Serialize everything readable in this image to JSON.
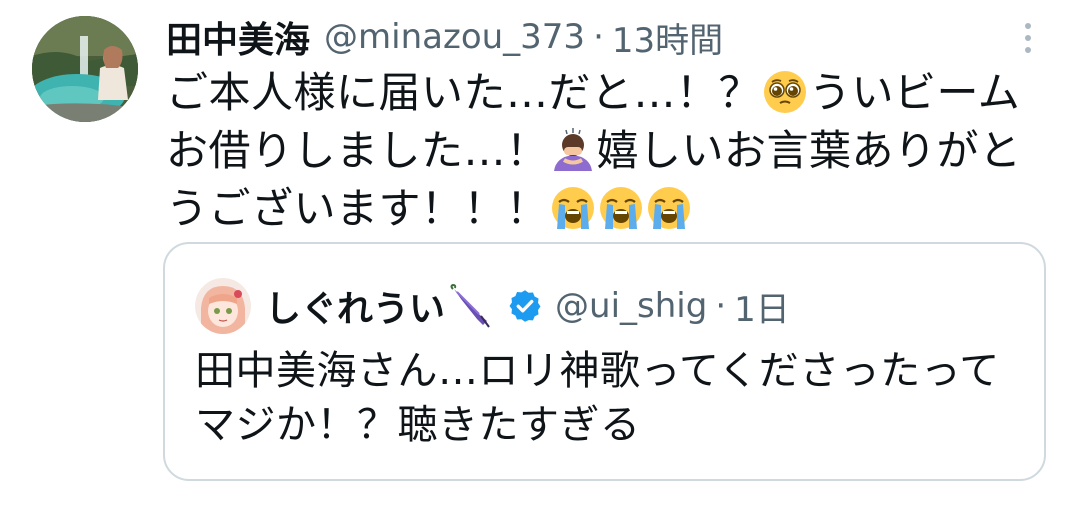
{
  "tweet": {
    "display_name": "田中美海",
    "handle": "@minazou_373",
    "separator": "·",
    "time": "13時間",
    "text_1": "ご本人様に届いた…だと…！？",
    "text_2": "ういビームお借りしました…！",
    "text_3": "嬉しいお言葉ありがとうございます！！！",
    "emojis": [
      "pleading-face",
      "woman-bowing",
      "loudly-crying-face",
      "loudly-crying-face",
      "loudly-crying-face"
    ]
  },
  "quote": {
    "display_name": "しぐれうい",
    "name_emoji": "closed-umbrella",
    "verified": true,
    "handle": "@ui_shig",
    "separator": "·",
    "time": "1日",
    "text": "田中美海さん…ロリ神歌ってくださったってマジか！？聴きたすぎる"
  },
  "colors": {
    "text_primary": "#0f1419",
    "text_secondary": "#536471",
    "border": "#cfd9de",
    "verified": "#1d9bf0"
  }
}
